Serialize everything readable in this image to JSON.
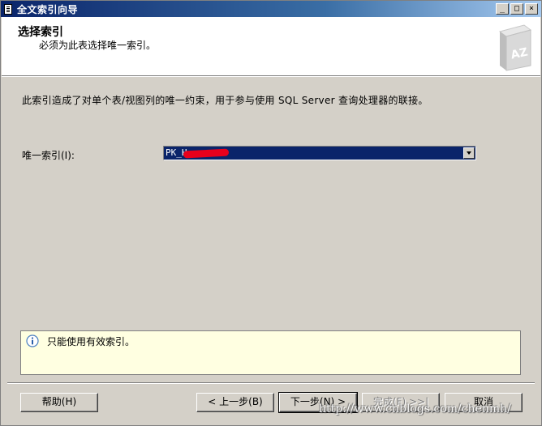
{
  "window": {
    "title": "全文索引向导",
    "controls": {
      "minimize": "_",
      "maximize": "□",
      "close": "×"
    }
  },
  "header": {
    "title": "选择索引",
    "subtitle": "必须为此表选择唯一索引。",
    "graphic": "book-az-icon",
    "graphic_text": "AZ"
  },
  "main": {
    "description": "此索引造成了对单个表/视图列的唯一约束，用于参与使用 SQL Server 查询处理器的联接。",
    "unique_index_label": "唯一索引(I):",
    "unique_index_value": "PK_H"
  },
  "info": {
    "icon": "info-icon",
    "text": "只能使用有效索引。"
  },
  "buttons": {
    "help": "帮助(H)",
    "back": "< 上一步(B)",
    "next": "下一步(N) >",
    "finish": "完成(F) >>|",
    "cancel": "取消"
  },
  "watermark": "http://www.cnblogs.com/chenmh/",
  "colors": {
    "titlebar": "#0a246a",
    "selection": "#0a246a",
    "info_bg": "#ffffe1",
    "redaction": "#e8001c"
  }
}
